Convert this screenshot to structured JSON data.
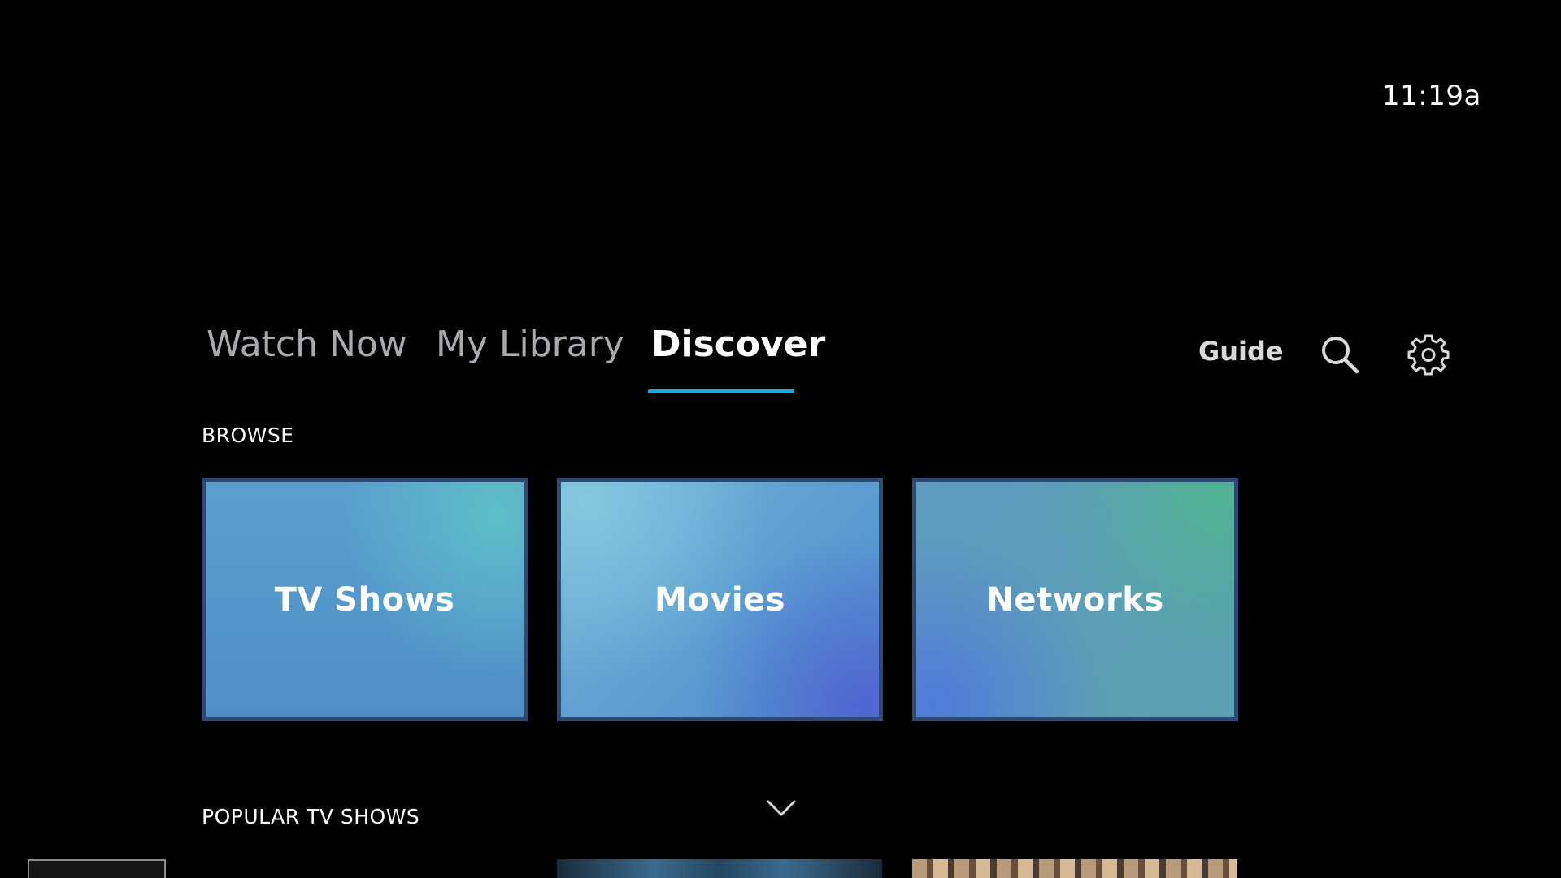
{
  "header": {
    "clock": "11:19a"
  },
  "nav": {
    "tabs": [
      {
        "label": "Watch Now"
      },
      {
        "label": "My Library"
      },
      {
        "label": "Discover"
      }
    ],
    "active_tab": "Discover",
    "guide_label": "Guide",
    "search_icon": "search-icon",
    "settings_icon": "gear-icon"
  },
  "browse": {
    "title": "BROWSE",
    "tiles": [
      {
        "label": "TV Shows"
      },
      {
        "label": "Movies"
      },
      {
        "label": "Networks"
      }
    ]
  },
  "popular": {
    "title": "POPULAR TV SHOWS",
    "expand_icon": "chevron-down-icon"
  },
  "colors": {
    "background": "#000000",
    "accent_underline": "#1fa9e1",
    "tile_border": "#2d4a72",
    "inactive_tab": "#a9aab0"
  }
}
